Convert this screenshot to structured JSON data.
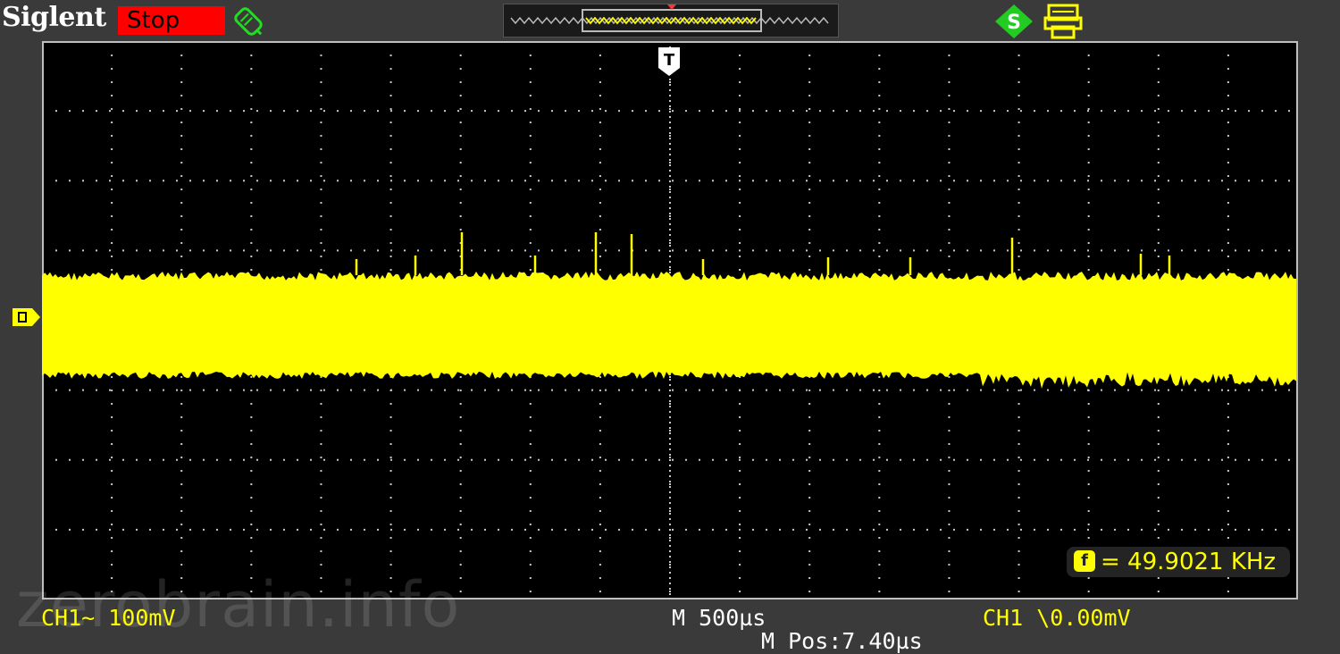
{
  "header": {
    "brand": "Siglent",
    "run_status": "Stop",
    "run_status_color": "#ff0000",
    "icons": [
      "probe-icon",
      "trigger-position-indicator",
      "usb-icon",
      "printer-icon"
    ]
  },
  "screen": {
    "trace_color": "#ffff00",
    "trigger_marker_label": "T"
  },
  "measurement": {
    "frequency_icon_glyph": "f",
    "frequency_text": "= 49.9021 KHz"
  },
  "footer": {
    "ch1_scale": "CH1~ 100mV",
    "timebase": "M 500µs",
    "m_pos": "M Pos:7.40µs",
    "trigger_level": "CH1 \\0.00mV"
  },
  "watermark": "zerobrain.info"
}
